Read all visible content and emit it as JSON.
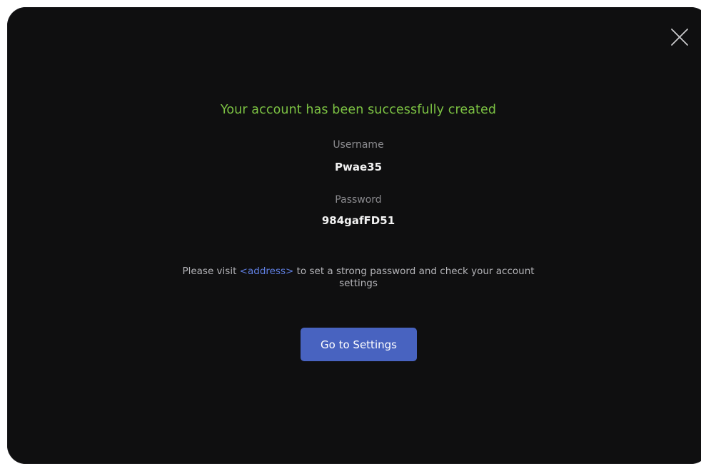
{
  "dialog": {
    "title": "Your account has been successfully created",
    "username": {
      "label": "Username",
      "value": "Pwae35"
    },
    "password": {
      "label": "Password",
      "value": "984gafFD51"
    },
    "info": {
      "prefix": "Please visit ",
      "link": "<address>",
      "suffix": " to set a strong password and check your account settings"
    },
    "button_label": "Go to Settings",
    "close_icon": "close-icon"
  },
  "colors": {
    "background": "#0f0f10",
    "title": "#7cc243",
    "label": "#8a8a8e",
    "value": "#f2f2f2",
    "text": "#b4b4b8",
    "link": "#5f7ee0",
    "button": "#4863c0"
  }
}
